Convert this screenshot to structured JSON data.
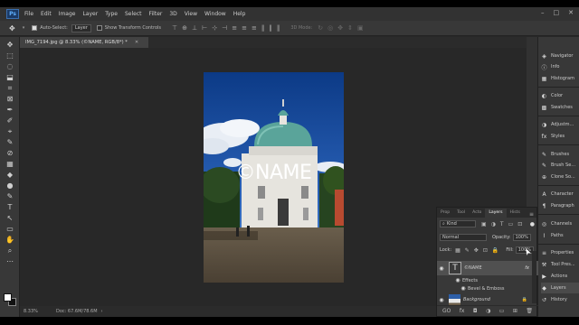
{
  "menubar": {
    "logo": "Ps",
    "items": [
      "File",
      "Edit",
      "Image",
      "Layer",
      "Type",
      "Select",
      "Filter",
      "3D",
      "View",
      "Window",
      "Help"
    ],
    "window_controls": [
      "–",
      "□",
      "✕"
    ]
  },
  "options": {
    "auto_select_label": "Auto-Select:",
    "auto_select_value": "Layer",
    "transform_label": "Show Transform Controls",
    "mode_3d": "3D Mode:"
  },
  "document": {
    "tab_title": "IMG_7194.jpg @ 8.33% (©NAME, RGB/8*) *",
    "watermark": "©NAME"
  },
  "status": {
    "zoom": "8.33%",
    "doc": "Doc: 67.6M/78.6M"
  },
  "right_panels": [
    {
      "label": "Navigator",
      "icon": "navigator-icon",
      "glyph": "◈"
    },
    {
      "label": "Info",
      "icon": "info-icon",
      "glyph": "ⓘ"
    },
    {
      "label": "Histogram",
      "icon": "histogram-icon",
      "glyph": "▦"
    },
    {
      "label": "Color",
      "icon": "color-icon",
      "glyph": "◐"
    },
    {
      "label": "Swatches",
      "icon": "swatches-icon",
      "glyph": "▩"
    },
    {
      "label": "Adjustm...",
      "icon": "adjustments-icon",
      "glyph": "◑"
    },
    {
      "label": "Styles",
      "icon": "styles-icon",
      "glyph": "fx"
    },
    {
      "label": "Brushes",
      "icon": "brushes-icon",
      "glyph": "✎"
    },
    {
      "label": "Brush Se...",
      "icon": "brush-settings-icon",
      "glyph": "✎"
    },
    {
      "label": "Clone So...",
      "icon": "clone-source-icon",
      "glyph": "⊕"
    },
    {
      "label": "Character",
      "icon": "character-icon",
      "glyph": "A"
    },
    {
      "label": "Paragraph",
      "icon": "paragraph-icon",
      "glyph": "¶"
    },
    {
      "label": "Channels",
      "icon": "channels-icon",
      "glyph": "◎"
    },
    {
      "label": "Paths",
      "icon": "paths-icon",
      "glyph": "⌇"
    },
    {
      "label": "Properties",
      "icon": "properties-icon",
      "glyph": "≡"
    },
    {
      "label": "Tool Pres...",
      "icon": "tool-presets-icon",
      "glyph": "⚒"
    },
    {
      "label": "Actions",
      "icon": "actions-icon",
      "glyph": "▶"
    },
    {
      "label": "Layers",
      "icon": "layers-icon",
      "glyph": "◆"
    },
    {
      "label": "History",
      "icon": "history-icon",
      "glyph": "↺"
    }
  ],
  "layers_panel": {
    "tabs": [
      "Prop",
      "Tool",
      "Acto",
      "Layers",
      "Hists"
    ],
    "active_tab": "Layers",
    "kind_label": "Kind",
    "blend_mode": "Normal",
    "opacity_label": "Opacity:",
    "opacity_value": "100%",
    "lock_label": "Lock:",
    "fill_label": "Fill:",
    "fill_value": "100%",
    "layers": [
      {
        "name": "©NAME",
        "thumb": "T",
        "fx": "fx"
      },
      {
        "name": "Effects"
      },
      {
        "name": "Bevel & Emboss"
      },
      {
        "name": "Background"
      }
    ],
    "footer_icons": [
      "GO",
      "fx",
      "◘",
      "◑",
      "▭",
      "⊞",
      "🗑"
    ]
  },
  "tools": [
    "✥",
    "⬚",
    "◌",
    "⬓",
    "⌗",
    "⊠",
    "✒",
    "✐",
    "⌖",
    "✎",
    "⊘",
    "▦",
    "◆",
    "●",
    "✎",
    "T",
    "↖",
    "▭",
    "✋",
    "⌕",
    "⋯"
  ]
}
